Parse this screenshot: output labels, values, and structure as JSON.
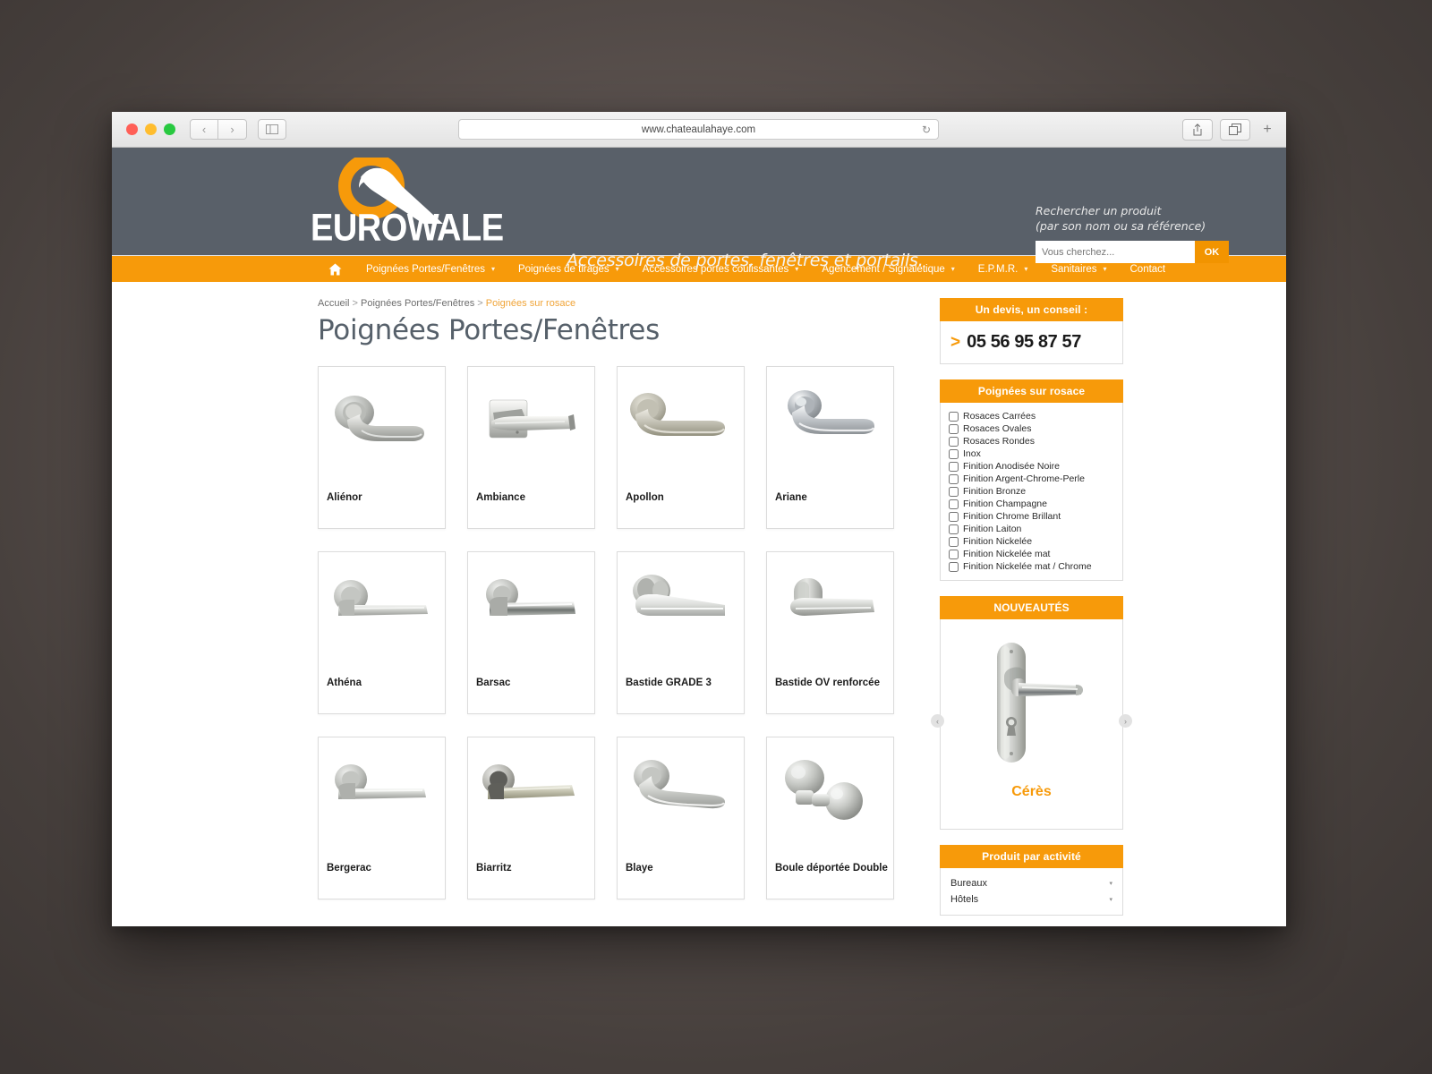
{
  "browser": {
    "url": "www.chateaulahaye.com",
    "back_label": "‹",
    "forward_label": "›",
    "reload_label": "↻",
    "new_tab_label": "+"
  },
  "header": {
    "logo_text": "EUROWALE",
    "tagline": "Accessoires de portes, fenêtres et portails.",
    "search_line1": "Rechercher un produit",
    "search_line2": "(par son nom ou sa référence)",
    "search_placeholder": "Vous cherchez...",
    "search_button": "OK"
  },
  "nav": {
    "items": [
      {
        "label": "Poignées Portes/Fenêtres",
        "caret": "▾"
      },
      {
        "label": "Poignées de tirages",
        "caret": "▾"
      },
      {
        "label": "Accessoires portes coulissantes",
        "caret": "▾"
      },
      {
        "label": "Agencement / Signalétique",
        "caret": "▾"
      },
      {
        "label": "E.P.M.R.",
        "caret": "▾"
      },
      {
        "label": "Sanitaires",
        "caret": "▾"
      },
      {
        "label": "Contact",
        "caret": ""
      }
    ]
  },
  "breadcrumb": {
    "home": "Accueil",
    "sep": ">",
    "level2": "Poignées Portes/Fenêtres",
    "current": "Poignées sur rosace"
  },
  "page": {
    "title": "Poignées Portes/Fenêtres"
  },
  "products": [
    {
      "name": "Aliénor",
      "style": "round-rose-curved"
    },
    {
      "name": "Ambiance",
      "style": "square-rose-flat"
    },
    {
      "name": "Apollon",
      "style": "round-rose-arc"
    },
    {
      "name": "Ariane",
      "style": "round-rose-chrome"
    },
    {
      "name": "Athéna",
      "style": "round-rose-straight"
    },
    {
      "name": "Barsac",
      "style": "round-rose-tube"
    },
    {
      "name": "Bastide GRADE 3",
      "style": "round-rose-angled"
    },
    {
      "name": "Bastide OV renforcée",
      "style": "oval-rose-tall"
    },
    {
      "name": "Bergerac",
      "style": "round-rose-slim"
    },
    {
      "name": "Biarritz",
      "style": "round-rose-dark"
    },
    {
      "name": "Blaye",
      "style": "round-rose-wave"
    },
    {
      "name": "Boule déportée Double",
      "style": "double-knob"
    }
  ],
  "sidebar": {
    "devis": {
      "title": "Un devis, un conseil :",
      "arrow": ">",
      "phone": "05 56 95 87 57"
    },
    "filters": {
      "title": "Poignées sur rosace",
      "items": [
        "Rosaces Carrées",
        "Rosaces Ovales",
        "Rosaces Rondes",
        "Inox",
        "Finition Anodisée Noire",
        "Finition Argent-Chrome-Perle",
        "Finition Bronze",
        "Finition Champagne",
        "Finition Chrome Brillant",
        "Finition Laiton",
        "Finition Nickelée",
        "Finition Nickelée mat",
        "Finition Nickelée mat / Chrome"
      ]
    },
    "nouveautes": {
      "title": "NOUVEAUTÉS",
      "item_name": "Cérès",
      "prev": "‹",
      "next": "›"
    },
    "activite": {
      "title": "Produit par activité",
      "options": [
        "Bureaux",
        "Hôtels"
      ],
      "tri": "▾"
    }
  },
  "colors": {
    "header_bg": "#596069",
    "accent_orange": "#f79a0a",
    "title_gray": "#56606a"
  }
}
